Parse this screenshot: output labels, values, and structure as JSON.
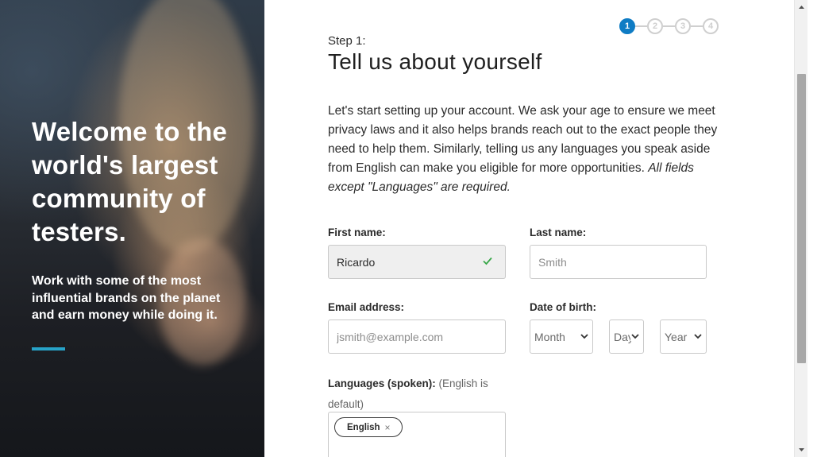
{
  "hero": {
    "title": "Welcome to the world's largest community of testers.",
    "subtitle": "Work with some of the most influential brands on the planet and earn money while doing it.",
    "accent_color": "#27a3c8"
  },
  "stepper": {
    "steps": [
      "1",
      "2",
      "3",
      "4"
    ],
    "current": 1,
    "active_color": "#0f7cc4"
  },
  "form": {
    "step_label": "Step 1:",
    "title": "Tell us about yourself",
    "intro_text": "Let's start setting up your account. We ask your age to ensure we meet privacy laws and it also helps brands reach out to the exact people they need to help them. Similarly, telling us any languages you speak aside from English can make you eligible for more opportunities.",
    "intro_emphasis": "All fields except \"Languages\" are required.",
    "first_name": {
      "label": "First name:",
      "value": "Ricardo",
      "valid_icon": "check-icon"
    },
    "last_name": {
      "label": "Last name:",
      "placeholder": "Smith"
    },
    "email": {
      "label": "Email address:",
      "placeholder": "jsmith@example.com"
    },
    "dob": {
      "label": "Date of birth:",
      "month": "Month",
      "day": "Day",
      "year": "Year"
    },
    "languages": {
      "label": "Languages (spoken):",
      "hint": "(English is default)",
      "chips": [
        {
          "label": "English",
          "remove": "×"
        }
      ]
    }
  }
}
